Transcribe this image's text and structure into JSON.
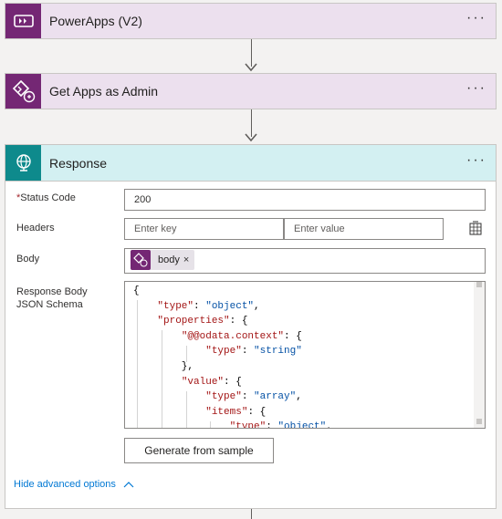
{
  "steps": [
    {
      "title": "PowerApps (V2)"
    },
    {
      "title": "Get Apps as Admin"
    },
    {
      "title": "Response"
    }
  ],
  "more_label": "···",
  "response": {
    "status_code": {
      "label": "Status Code",
      "required_mark": "*",
      "value": "200"
    },
    "headers": {
      "label": "Headers",
      "key_placeholder": "Enter key",
      "value_placeholder": "Enter value"
    },
    "body": {
      "label": "Body",
      "token_label": "body",
      "token_remove": "×"
    },
    "schema": {
      "label": "Response Body JSON Schema",
      "lines": [
        "{",
        "    \"type\": \"object\",",
        "    \"properties\": {",
        "        \"@@odata.context\": {",
        "            \"type\": \"string\"",
        "        },",
        "        \"value\": {",
        "            \"type\": \"array\",",
        "            \"items\": {",
        "                \"type\": \"object\","
      ]
    },
    "generate_button": "Generate from sample",
    "hide_advanced": "Hide advanced options"
  },
  "colors": {
    "powerapps_purple": "#742774",
    "response_teal": "#0e8a8c",
    "link_blue": "#0078d4"
  }
}
